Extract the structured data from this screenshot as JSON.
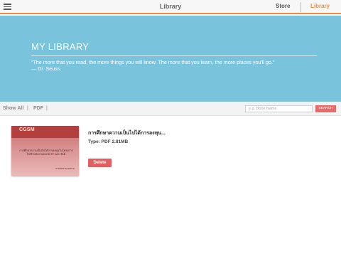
{
  "topbar": {
    "title": "Library",
    "tabs": [
      {
        "label": "Store",
        "active": false
      },
      {
        "label": "Library",
        "active": true
      }
    ],
    "accent_color": "#f08a3c"
  },
  "hero": {
    "title": "MY LIBRARY",
    "quote": "“The more that you read, the more things you will know. The more that you learn, the more places you'll go.”",
    "quote_author": "— Dr. Seuss.",
    "background_color": "#79c3dd"
  },
  "filters": {
    "items": [
      "Show All",
      "PDF"
    ],
    "separators": [
      "|",
      "|"
    ],
    "search": {
      "placeholder": "e.g. Book Name",
      "value": "",
      "button_label": "SEARCH"
    }
  },
  "books": [
    {
      "title": "การศึกษาความเป็นไปได้การลงทุน...",
      "type_line": "Type: PDF 2.81MB",
      "delete_label": "Delete",
      "cover": {
        "logo_text": "CGSM",
        "line1": "การศึกษาความเป็นไปได้การลงทุนในโครงการ",
        "line2": "ไฟฟ้าพลังงานขนาด ต่า เมกะวัตต์",
        "footer": "นายสมชาย สมชาย"
      }
    }
  ]
}
